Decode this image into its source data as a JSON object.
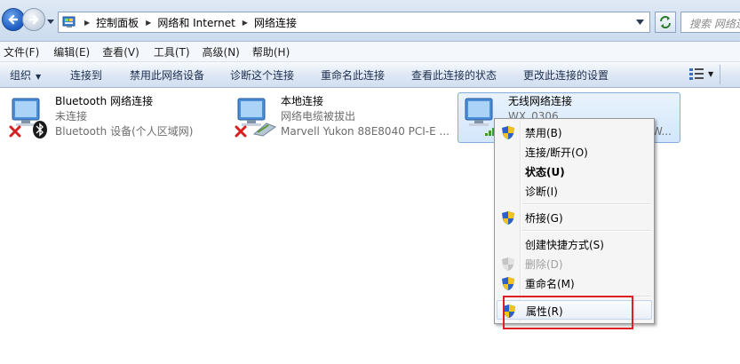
{
  "address": {
    "crumbs": [
      "控制面板",
      "网络和 Internet",
      "网络连接"
    ],
    "search_placeholder": "搜索 网络连"
  },
  "menubar": {
    "items": [
      "文件(F)",
      "编辑(E)",
      "查看(V)",
      "工具(T)",
      "高级(N)",
      "帮助(H)"
    ]
  },
  "toolbar": {
    "organize": "组织",
    "connect_to": "连接到",
    "disable": "禁用此网络设备",
    "diagnose": "诊断这个连接",
    "rename": "重命名此连接",
    "view_status": "查看此连接的状态",
    "change_settings": "更改此连接的设置"
  },
  "connections": [
    {
      "name": "Bluetooth 网络连接",
      "status": "未连接",
      "device": "Bluetooth 设备(个人区域网)"
    },
    {
      "name": "本地连接",
      "status": "网络电缆被拔出",
      "device": "Marvell Yukon 88E8040 PCI-E ..."
    },
    {
      "name": "无线网络连接",
      "status": "WX_0306",
      "device": "W..."
    }
  ],
  "context_menu": {
    "items": [
      {
        "label": "禁用(B)"
      },
      {
        "label": "连接/断开(O)"
      },
      {
        "label": "状态(U)"
      },
      {
        "label": "诊断(I)"
      },
      {
        "label": "桥接(G)"
      },
      {
        "label": "创建快捷方式(S)"
      },
      {
        "label": "删除(D)"
      },
      {
        "label": "重命名(M)"
      },
      {
        "label": "属性(R)"
      }
    ]
  },
  "colors": {
    "highlight": "#e02020",
    "selection_border": "#84acdd",
    "shield_blue": "#2c62c8",
    "shield_yellow": "#f2c419"
  }
}
